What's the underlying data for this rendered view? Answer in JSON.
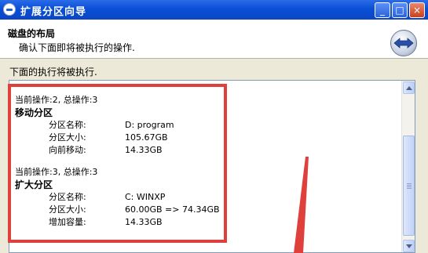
{
  "window": {
    "title": "扩展分区向导",
    "buttons": [
      "minimize",
      "maximize",
      "close"
    ]
  },
  "header": {
    "title": "磁盘的布局",
    "subtitle": "确认下面即将被执行的操作."
  },
  "body": {
    "label": "下面的执行将被执行."
  },
  "operations": [
    {
      "counter": "当前操作:2, 总操作:3",
      "name": "移动分区",
      "fields": [
        {
          "key": "分区名称:",
          "value": "D: program"
        },
        {
          "key": "分区大小:",
          "value": "105.67GB"
        },
        {
          "key": "向前移动:",
          "value": "14.33GB"
        }
      ]
    },
    {
      "counter": "当前操作:3, 总操作:3",
      "name": "扩大分区",
      "fields": [
        {
          "key": "分区名称:",
          "value": "C: WINXP"
        },
        {
          "key": "分区大小:",
          "value": "60.00GB => 74.34GB"
        },
        {
          "key": "增加容量:",
          "value": "14.33GB"
        }
      ]
    }
  ],
  "colors": {
    "titlebar": "#0a4fd6",
    "highlight": "#e0403c",
    "window_bg": "#ece9d8"
  }
}
